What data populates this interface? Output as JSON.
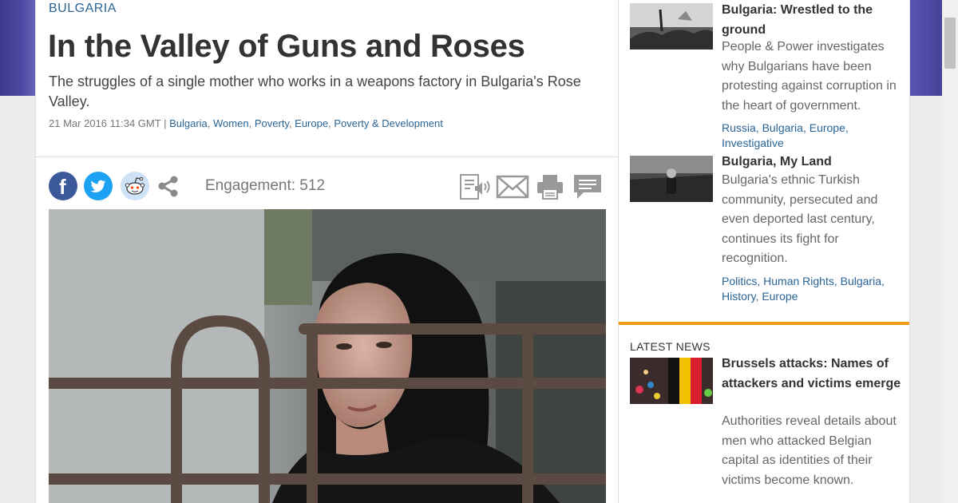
{
  "article": {
    "section": "BULGARIA",
    "title": "In the Valley of Guns and Roses",
    "standfirst": "The struggles of a single mother who works in a weapons factory in Bulgaria's Rose Valley.",
    "date": "21 Mar 2016 11:34 GMT",
    "separator": "|",
    "tags": [
      "Bulgaria",
      "Women",
      "Poverty",
      "Europe",
      "Poverty & Development"
    ],
    "engagement_label": "Engagement: 512"
  },
  "share": {
    "icons": [
      "facebook-icon",
      "twitter-icon",
      "reddit-icon",
      "share-icon"
    ],
    "tools": [
      "listen-icon",
      "email-icon",
      "print-icon",
      "comments-icon"
    ]
  },
  "sidebar": {
    "related": [
      {
        "title": "Bulgaria: Wrestled to the ground",
        "description": "People & Power investigates why Bulgarians have been protesting against corruption in the heart of government.",
        "tags": [
          "Russia",
          "Bulgaria",
          "Europe",
          "Investigative"
        ]
      },
      {
        "title": "Bulgaria, My Land",
        "description": "Bulgaria's ethnic Turkish community, persecuted and even deported last century, continues its fight for recognition.",
        "tags": [
          "Politics",
          "Human Rights",
          "Bulgaria",
          "History",
          "Europe"
        ]
      }
    ],
    "latest_label": "LATEST NEWS",
    "latest": [
      {
        "title": "Brussels attacks: Names of attackers and victims emerge",
        "description": "Authorities reveal details about men who attacked Belgian capital as identities of their victims become known."
      }
    ]
  },
  "colors": {
    "link": "#2a6496",
    "accent_rule": "#f39c12",
    "header_band": "#4e4aa3"
  }
}
